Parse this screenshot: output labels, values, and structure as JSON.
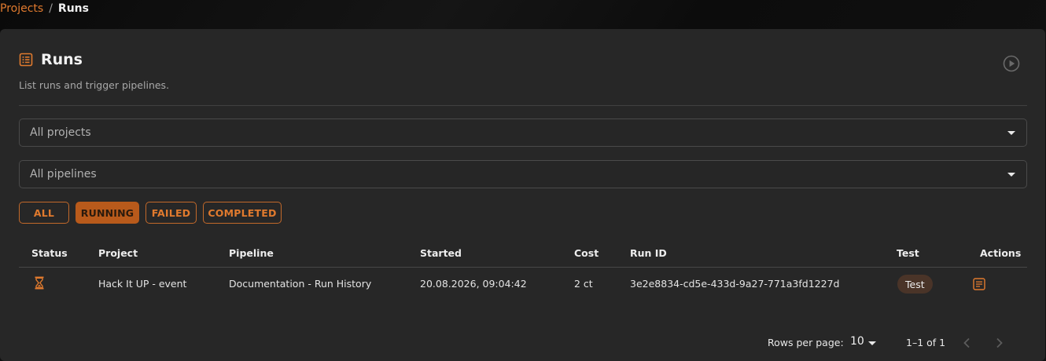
{
  "breadcrumb": {
    "parent": "Projects",
    "separator": "/",
    "current": "Runs"
  },
  "header": {
    "title": "Runs",
    "subtitle": "List runs and trigger pipelines.",
    "title_icon": "list-icon",
    "action_icon": "play-circle-icon"
  },
  "filters": {
    "projects_placeholder": "All projects",
    "pipelines_placeholder": "All pipelines",
    "status_chips": [
      {
        "label": "ALL",
        "selected": false
      },
      {
        "label": "RUNNING",
        "selected": true
      },
      {
        "label": "FAILED",
        "selected": false
      },
      {
        "label": "COMPLETED",
        "selected": false
      }
    ]
  },
  "table": {
    "columns": [
      "Status",
      "Project",
      "Pipeline",
      "Started",
      "Cost",
      "Run ID",
      "Test",
      "Actions"
    ],
    "rows": [
      {
        "status_icon": "hourglass-icon",
        "project": "Hack It UP - event",
        "pipeline": "Documentation - Run History",
        "started": "20.08.2026, 09:04:42",
        "cost": "2 ct",
        "run_id": "3e2e8834-cd5e-433d-9a27-771a3fd1227d",
        "test": "Test",
        "action_icon": "document-icon"
      }
    ]
  },
  "pagination": {
    "rows_per_page_label": "Rows per page:",
    "rows_per_page": "10",
    "range": "1–1 of 1"
  },
  "colors": {
    "accent": "#e07a2e",
    "accent_fill": "#b85a1b",
    "card": "#272727",
    "badge": "#4a3428"
  }
}
